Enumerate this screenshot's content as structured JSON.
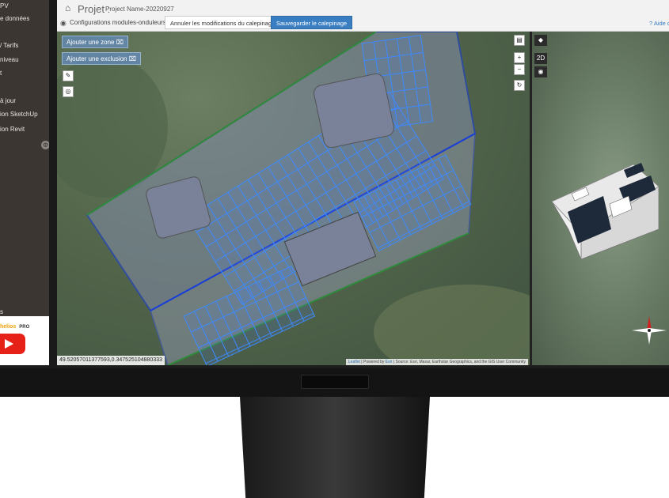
{
  "sidebar": {
    "items": [
      {
        "label": "PV"
      },
      {
        "label": "e données"
      },
      {
        "label": "/ Tarifs"
      },
      {
        "label": "niveau"
      },
      {
        "label": "t"
      },
      {
        "label": "à jour"
      },
      {
        "label": "ion SketchUp"
      },
      {
        "label": "ion Revit"
      },
      {
        "label": "s"
      }
    ],
    "brand": "helios",
    "brand_suffix": "PRO"
  },
  "header": {
    "title_label": "Projet :",
    "project_name": "Project Name-20220927",
    "config_label": "Configurations modules-onduleurs",
    "cancel_label": "Annuler les modifications du calepinage",
    "save_label": "Sauvegarder le calepinage",
    "help_label": "? Aide d"
  },
  "map": {
    "add_zone_label": "Ajouter une zone",
    "add_exclusion_label": "Ajouter une exclusion",
    "zoom_in": "+",
    "zoom_out": "−",
    "coordinates": "49.52057011377593,0.347525104880333",
    "attribution_leaflet": "Leaflet",
    "attribution_powered": "| Powered by",
    "attribution_esri": "Esri",
    "attribution_source": "| Source: Esri, Maxar, Earthstar Geographics, and the GIS User Community"
  },
  "view3d": {
    "mode_label": "2D"
  },
  "colors": {
    "accent": "#3a7ec2",
    "panel_grid": "#3d8bff",
    "roof_outline": "#1a3fd6",
    "sidebar_bg": "#3b3632"
  }
}
